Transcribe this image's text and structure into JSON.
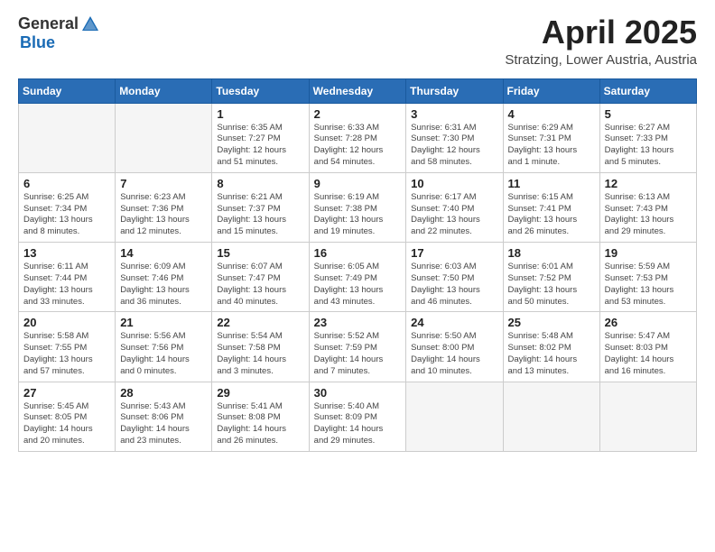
{
  "header": {
    "logo_general": "General",
    "logo_blue": "Blue",
    "month_title": "April 2025",
    "location": "Stratzing, Lower Austria, Austria"
  },
  "weekdays": [
    "Sunday",
    "Monday",
    "Tuesday",
    "Wednesday",
    "Thursday",
    "Friday",
    "Saturday"
  ],
  "weeks": [
    [
      {
        "day": "",
        "info": ""
      },
      {
        "day": "",
        "info": ""
      },
      {
        "day": "1",
        "info": "Sunrise: 6:35 AM\nSunset: 7:27 PM\nDaylight: 12 hours\nand 51 minutes."
      },
      {
        "day": "2",
        "info": "Sunrise: 6:33 AM\nSunset: 7:28 PM\nDaylight: 12 hours\nand 54 minutes."
      },
      {
        "day": "3",
        "info": "Sunrise: 6:31 AM\nSunset: 7:30 PM\nDaylight: 12 hours\nand 58 minutes."
      },
      {
        "day": "4",
        "info": "Sunrise: 6:29 AM\nSunset: 7:31 PM\nDaylight: 13 hours\nand 1 minute."
      },
      {
        "day": "5",
        "info": "Sunrise: 6:27 AM\nSunset: 7:33 PM\nDaylight: 13 hours\nand 5 minutes."
      }
    ],
    [
      {
        "day": "6",
        "info": "Sunrise: 6:25 AM\nSunset: 7:34 PM\nDaylight: 13 hours\nand 8 minutes."
      },
      {
        "day": "7",
        "info": "Sunrise: 6:23 AM\nSunset: 7:36 PM\nDaylight: 13 hours\nand 12 minutes."
      },
      {
        "day": "8",
        "info": "Sunrise: 6:21 AM\nSunset: 7:37 PM\nDaylight: 13 hours\nand 15 minutes."
      },
      {
        "day": "9",
        "info": "Sunrise: 6:19 AM\nSunset: 7:38 PM\nDaylight: 13 hours\nand 19 minutes."
      },
      {
        "day": "10",
        "info": "Sunrise: 6:17 AM\nSunset: 7:40 PM\nDaylight: 13 hours\nand 22 minutes."
      },
      {
        "day": "11",
        "info": "Sunrise: 6:15 AM\nSunset: 7:41 PM\nDaylight: 13 hours\nand 26 minutes."
      },
      {
        "day": "12",
        "info": "Sunrise: 6:13 AM\nSunset: 7:43 PM\nDaylight: 13 hours\nand 29 minutes."
      }
    ],
    [
      {
        "day": "13",
        "info": "Sunrise: 6:11 AM\nSunset: 7:44 PM\nDaylight: 13 hours\nand 33 minutes."
      },
      {
        "day": "14",
        "info": "Sunrise: 6:09 AM\nSunset: 7:46 PM\nDaylight: 13 hours\nand 36 minutes."
      },
      {
        "day": "15",
        "info": "Sunrise: 6:07 AM\nSunset: 7:47 PM\nDaylight: 13 hours\nand 40 minutes."
      },
      {
        "day": "16",
        "info": "Sunrise: 6:05 AM\nSunset: 7:49 PM\nDaylight: 13 hours\nand 43 minutes."
      },
      {
        "day": "17",
        "info": "Sunrise: 6:03 AM\nSunset: 7:50 PM\nDaylight: 13 hours\nand 46 minutes."
      },
      {
        "day": "18",
        "info": "Sunrise: 6:01 AM\nSunset: 7:52 PM\nDaylight: 13 hours\nand 50 minutes."
      },
      {
        "day": "19",
        "info": "Sunrise: 5:59 AM\nSunset: 7:53 PM\nDaylight: 13 hours\nand 53 minutes."
      }
    ],
    [
      {
        "day": "20",
        "info": "Sunrise: 5:58 AM\nSunset: 7:55 PM\nDaylight: 13 hours\nand 57 minutes."
      },
      {
        "day": "21",
        "info": "Sunrise: 5:56 AM\nSunset: 7:56 PM\nDaylight: 14 hours\nand 0 minutes."
      },
      {
        "day": "22",
        "info": "Sunrise: 5:54 AM\nSunset: 7:58 PM\nDaylight: 14 hours\nand 3 minutes."
      },
      {
        "day": "23",
        "info": "Sunrise: 5:52 AM\nSunset: 7:59 PM\nDaylight: 14 hours\nand 7 minutes."
      },
      {
        "day": "24",
        "info": "Sunrise: 5:50 AM\nSunset: 8:00 PM\nDaylight: 14 hours\nand 10 minutes."
      },
      {
        "day": "25",
        "info": "Sunrise: 5:48 AM\nSunset: 8:02 PM\nDaylight: 14 hours\nand 13 minutes."
      },
      {
        "day": "26",
        "info": "Sunrise: 5:47 AM\nSunset: 8:03 PM\nDaylight: 14 hours\nand 16 minutes."
      }
    ],
    [
      {
        "day": "27",
        "info": "Sunrise: 5:45 AM\nSunset: 8:05 PM\nDaylight: 14 hours\nand 20 minutes."
      },
      {
        "day": "28",
        "info": "Sunrise: 5:43 AM\nSunset: 8:06 PM\nDaylight: 14 hours\nand 23 minutes."
      },
      {
        "day": "29",
        "info": "Sunrise: 5:41 AM\nSunset: 8:08 PM\nDaylight: 14 hours\nand 26 minutes."
      },
      {
        "day": "30",
        "info": "Sunrise: 5:40 AM\nSunset: 8:09 PM\nDaylight: 14 hours\nand 29 minutes."
      },
      {
        "day": "",
        "info": ""
      },
      {
        "day": "",
        "info": ""
      },
      {
        "day": "",
        "info": ""
      }
    ]
  ]
}
